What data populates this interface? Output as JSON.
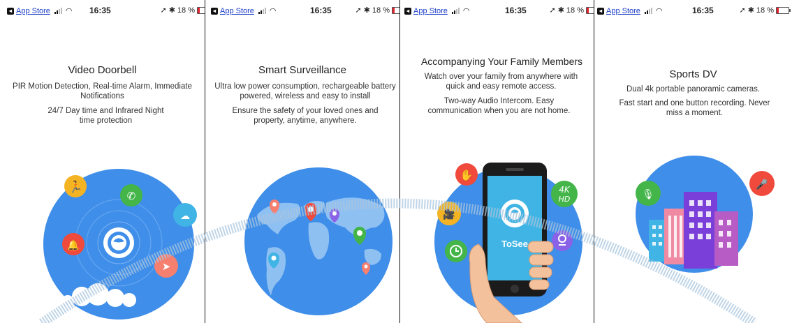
{
  "status_bar": {
    "back_app": "App Store",
    "time": "16:35",
    "battery": "18 %",
    "icons": [
      "back-arrow-icon",
      "signal-icon",
      "wifi-icon",
      "location-arrow-icon",
      "bluetooth-icon",
      "battery-icon"
    ]
  },
  "screens": [
    {
      "title": "Video Doorbell",
      "desc1": "PIR Motion Detection, Real-time Alarm, Immediate Notifications",
      "desc2": "24/7 Day time and Infrared Night time protection",
      "illustration": "doorbell-circle-icon"
    },
    {
      "title": "Smart Surveillance",
      "desc1": "Ultra low power consumption, rechargeable battery powered, wireless and easy to install",
      "desc2": "Ensure the safety of your loved ones and property, anytime, anywhere.",
      "illustration": "world-map-icon"
    },
    {
      "title": "Accompanying Your Family Members",
      "desc1": "Watch over your family from anywhere with quick and easy remote access.",
      "desc2": "Two-way Audio Intercom. Easy communication when you are not home.",
      "phone_brand": "ToSee",
      "badge_4k": "4K",
      "badge_hd": "HD"
    },
    {
      "title": "Sports DV",
      "desc1": "Dual 4k portable panoramic cameras.",
      "desc2": "Fast start and one button recording. Never miss a moment.",
      "illustration": "city-buildings-icon"
    }
  ],
  "colors": {
    "accent_blue": "#3f8ee9",
    "arc": "#a9c6de",
    "link": "#1a3cc7",
    "battery_low": "#e5222d"
  }
}
